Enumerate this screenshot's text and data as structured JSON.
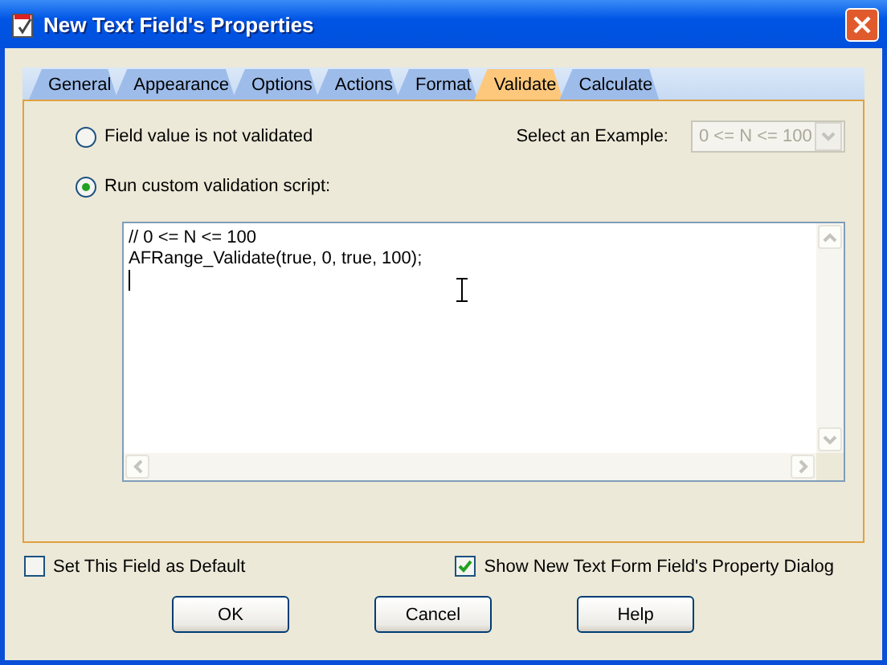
{
  "window": {
    "title": "New Text Field's Properties"
  },
  "tabs": [
    {
      "label": "General",
      "selected": false
    },
    {
      "label": "Appearance",
      "selected": false
    },
    {
      "label": "Options",
      "selected": false
    },
    {
      "label": "Actions",
      "selected": false
    },
    {
      "label": "Format",
      "selected": false
    },
    {
      "label": "Validate",
      "selected": true
    },
    {
      "label": "Calculate",
      "selected": false
    }
  ],
  "options": [
    {
      "label": "Field value is not validated",
      "selected": false
    },
    {
      "label": "Run custom validation script:",
      "selected": true
    }
  ],
  "example": {
    "label": "Select an Example:",
    "value": "0 <= N <= 100",
    "disabled": true
  },
  "script": {
    "lines": [
      "// 0 <= N <= 100",
      "AFRange_Validate(true, 0, true, 100);"
    ]
  },
  "checkboxes": [
    {
      "label": "Set This Field as Default",
      "checked": false
    },
    {
      "label": "Show New Text Form Field's Property Dialog",
      "checked": true
    }
  ],
  "buttons": [
    "OK",
    "Cancel",
    "Help"
  ]
}
